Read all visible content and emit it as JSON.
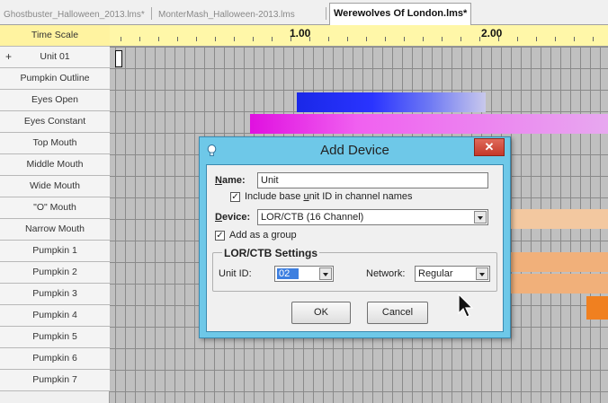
{
  "tabs": [
    {
      "label": "Ghostbuster_Halloween_2013.lms*",
      "active": false
    },
    {
      "label": "MonterMash_Halloween-2013.lms",
      "active": false
    },
    {
      "label": "Werewolves Of London.lms*",
      "active": true
    }
  ],
  "channels": {
    "header": "Time Scale",
    "expand_glyph": "+",
    "items": [
      "Unit 01",
      "Pumpkin Outline",
      "Eyes Open",
      "Eyes Constant",
      "Top Mouth",
      "Middle Mouth",
      "Wide Mouth",
      "\"O\" Mouth",
      "Narrow Mouth",
      "Pumpkin 1",
      "Pumpkin 2",
      "Pumpkin 3",
      "Pumpkin 4",
      "Pumpkin 5",
      "Pumpkin 6",
      "Pumpkin 7"
    ]
  },
  "timeline": {
    "marks": [
      "1.00",
      "2.00"
    ],
    "colors": {
      "eyes_open": "#2a34ff",
      "eyes_constant": "#e010e0",
      "pumpkin_fade": "#f3c8a0",
      "pumpkin_solid": "#f08020"
    }
  },
  "dialog": {
    "title": "Add Device",
    "close_glyph": "✕",
    "icon": "lightbulb-icon",
    "name_label_accel": "N",
    "name_label_rest": "ame:",
    "name_value": "Unit",
    "include_unit_id_checked": true,
    "include_unit_id_pre": "Include base ",
    "include_unit_id_accel": "u",
    "include_unit_id_post": "nit ID in channel names",
    "device_label_accel": "D",
    "device_label_rest": "evice:",
    "device_value": "LOR/CTB (16 Channel)",
    "add_as_group_checked": true,
    "add_as_group_label": "Add as a group",
    "settings_group": "LOR/CTB Settings",
    "unit_id_label": "Unit ID:",
    "unit_id_value": "02",
    "network_label": "Network:",
    "network_value": "Regular",
    "ok_label": "OK",
    "cancel_label": "Cancel",
    "check_glyph": "✓"
  }
}
